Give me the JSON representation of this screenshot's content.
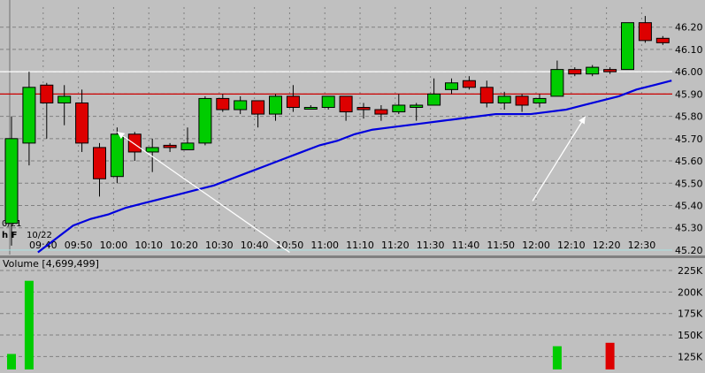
{
  "chart_data": [
    {
      "type": "candlestick",
      "title": "",
      "ylim": [
        45.18,
        46.29
      ],
      "grid": true,
      "y_ticks": [
        45.2,
        45.3,
        45.4,
        45.5,
        45.6,
        45.7,
        45.8,
        45.9,
        46.0,
        46.1,
        46.2
      ],
      "y_tick_labels": [
        "45.20",
        "45.30",
        "45.40",
        "45.50",
        "45.60",
        "45.70",
        "45.80",
        "45.90",
        "46.00",
        "46.10",
        "46.20"
      ],
      "x_tick_labels": [
        "09:40",
        "09:50",
        "10:00",
        "10:10",
        "10:20",
        "10:30",
        "10:40",
        "10:50",
        "11:00",
        "11:10",
        "11:20",
        "11:30",
        "11:40",
        "11:50",
        "12:00",
        "12:10",
        "12:20",
        "12:30"
      ],
      "date_labels": [
        "0/21",
        "10/22"
      ],
      "corner_label": "h F",
      "x_start": "09:31",
      "bar_minutes": 5,
      "candles": [
        {
          "o": 45.32,
          "h": 45.8,
          "l": 45.22,
          "c": 45.7
        },
        {
          "o": 45.68,
          "h": 46.0,
          "l": 45.58,
          "c": 45.93
        },
        {
          "o": 45.94,
          "h": 45.95,
          "l": 45.7,
          "c": 45.86
        },
        {
          "o": 45.86,
          "h": 45.94,
          "l": 45.76,
          "c": 45.89
        },
        {
          "o": 45.86,
          "h": 45.92,
          "l": 45.64,
          "c": 45.68
        },
        {
          "o": 45.66,
          "h": 45.68,
          "l": 45.44,
          "c": 45.52
        },
        {
          "o": 45.53,
          "h": 45.75,
          "l": 45.5,
          "c": 45.72
        },
        {
          "o": 45.72,
          "h": 45.73,
          "l": 45.6,
          "c": 45.64
        },
        {
          "o": 45.64,
          "h": 45.7,
          "l": 45.55,
          "c": 45.66
        },
        {
          "o": 45.67,
          "h": 45.68,
          "l": 45.64,
          "c": 45.66
        },
        {
          "o": 45.65,
          "h": 45.75,
          "l": 45.65,
          "c": 45.68
        },
        {
          "o": 45.68,
          "h": 45.89,
          "l": 45.67,
          "c": 45.88
        },
        {
          "o": 45.88,
          "h": 45.9,
          "l": 45.82,
          "c": 45.83
        },
        {
          "o": 45.83,
          "h": 45.89,
          "l": 45.81,
          "c": 45.87
        },
        {
          "o": 45.87,
          "h": 45.87,
          "l": 45.75,
          "c": 45.81
        },
        {
          "o": 45.81,
          "h": 45.9,
          "l": 45.78,
          "c": 45.89
        },
        {
          "o": 45.89,
          "h": 45.94,
          "l": 45.82,
          "c": 45.84
        },
        {
          "o": 45.84,
          "h": 45.85,
          "l": 45.83,
          "c": 45.84
        },
        {
          "o": 45.84,
          "h": 45.89,
          "l": 45.83,
          "c": 45.89
        },
        {
          "o": 45.89,
          "h": 45.89,
          "l": 45.78,
          "c": 45.82
        },
        {
          "o": 45.84,
          "h": 45.86,
          "l": 45.79,
          "c": 45.83
        },
        {
          "o": 45.83,
          "h": 45.85,
          "l": 45.78,
          "c": 45.81
        },
        {
          "o": 45.82,
          "h": 45.9,
          "l": 45.81,
          "c": 45.85
        },
        {
          "o": 45.84,
          "h": 45.86,
          "l": 45.78,
          "c": 45.85
        },
        {
          "o": 45.85,
          "h": 45.97,
          "l": 45.85,
          "c": 45.9
        },
        {
          "o": 45.92,
          "h": 45.97,
          "l": 45.9,
          "c": 45.95
        },
        {
          "o": 45.96,
          "h": 45.98,
          "l": 45.92,
          "c": 45.93
        },
        {
          "o": 45.93,
          "h": 45.96,
          "l": 45.84,
          "c": 45.86
        },
        {
          "o": 45.86,
          "h": 45.91,
          "l": 45.83,
          "c": 45.89
        },
        {
          "o": 45.89,
          "h": 45.9,
          "l": 45.82,
          "c": 45.85
        },
        {
          "o": 45.86,
          "h": 45.9,
          "l": 45.84,
          "c": 45.88
        },
        {
          "o": 45.89,
          "h": 46.05,
          "l": 45.89,
          "c": 46.01
        },
        {
          "o": 46.01,
          "h": 46.02,
          "l": 45.98,
          "c": 45.99
        },
        {
          "o": 45.99,
          "h": 46.03,
          "l": 45.98,
          "c": 46.02
        },
        {
          "o": 46.01,
          "h": 46.02,
          "l": 45.99,
          "c": 46.0
        },
        {
          "o": 46.01,
          "h": 46.22,
          "l": 46.01,
          "c": 46.22
        },
        {
          "o": 46.22,
          "h": 46.25,
          "l": 46.13,
          "c": 46.14
        },
        {
          "o": 46.15,
          "h": 46.16,
          "l": 46.12,
          "c": 46.13
        }
      ],
      "moving_average": [
        45.19,
        45.25,
        45.31,
        45.34,
        45.36,
        45.39,
        45.41,
        45.43,
        45.45,
        45.47,
        45.49,
        45.52,
        45.55,
        45.58,
        45.61,
        45.64,
        45.67,
        45.69,
        45.72,
        45.74,
        45.75,
        45.76,
        45.77,
        45.78,
        45.79,
        45.8,
        45.81,
        45.81,
        45.81,
        45.82,
        45.83,
        45.85,
        45.87,
        45.89,
        45.92,
        45.94,
        45.96
      ],
      "reference_lines": [
        {
          "value": 46.0,
          "color": "#ffffff"
        },
        {
          "value": 45.9,
          "color": "#cc0000"
        },
        {
          "value": 45.2,
          "color": "#aadddd"
        }
      ],
      "annotations": [
        {
          "type": "arrow",
          "from": {
            "x": "10:50",
            "y": 45.19
          },
          "to": {
            "x": "10:01",
            "y": 45.73
          },
          "color": "#ffffff"
        },
        {
          "type": "arrow",
          "from": {
            "x": "11:59",
            "y": 45.42
          },
          "to": {
            "x": "12:14",
            "y": 45.8
          },
          "color": "#ffffff"
        }
      ],
      "colors": {
        "background": "#c0c0c0",
        "up": "#00cc00",
        "down": "#dd0000",
        "ma": "#0000dd",
        "grid": "#808080",
        "text": "#000000"
      }
    },
    {
      "type": "bar",
      "title": "Volume",
      "legend_value": "[4,699,499]",
      "ylim": [
        110000,
        225000
      ],
      "y_ticks": [
        125000,
        150000,
        175000,
        200000,
        225000
      ],
      "y_tick_labels": [
        "125K",
        "150K",
        "175K",
        "200K",
        "225K"
      ],
      "visible_bars": [
        {
          "bar_index": 0,
          "value": 128000,
          "direction": "up"
        },
        {
          "bar_index": 1,
          "value": 213000,
          "direction": "up"
        },
        {
          "bar_index": 31,
          "value": 137000,
          "direction": "up"
        },
        {
          "bar_index": 34,
          "value": 141000,
          "direction": "down"
        }
      ]
    }
  ]
}
